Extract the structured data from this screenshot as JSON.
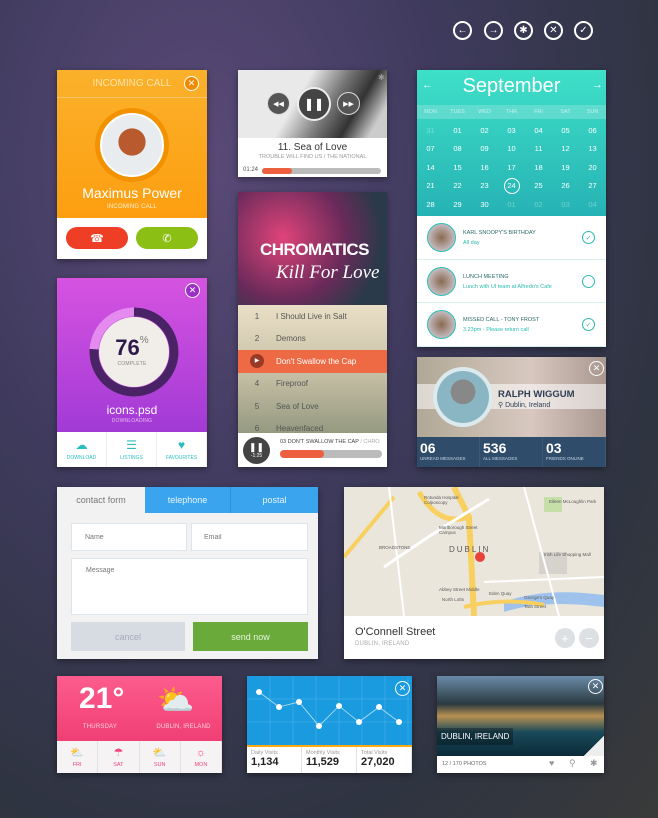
{
  "top_toolbar": {
    "icons": [
      "arrow-left-icon",
      "arrow-right-icon",
      "gear-icon",
      "close-icon",
      "check-icon"
    ]
  },
  "call": {
    "header": "INCOMING CALL",
    "name": "Maximus Power",
    "status": "INCOMING CALL",
    "color": "#fba21b"
  },
  "player": {
    "title": "11. Sea of Love",
    "subtitle": "TROUBLE WILL FIND US  /  THE NATIONAL",
    "time": "01:24",
    "progress": 0.25
  },
  "album": {
    "art_title": "CHROMATICS",
    "art_subtitle": "Kill For Love",
    "tracks": [
      {
        "n": "1",
        "title": "I Should Live in Salt"
      },
      {
        "n": "2",
        "title": "Demons"
      },
      {
        "n": "3",
        "title": "Don't Swallow the Cap",
        "active": true
      },
      {
        "n": "4",
        "title": "Fireproof"
      },
      {
        "n": "5",
        "title": "Sea of Love"
      },
      {
        "n": "6",
        "title": "Heavenfaced"
      }
    ],
    "now_playing": "03 DON'T SWALLOW THE CAP",
    "now_playing_sep": " / CHRO",
    "remaining": "-1:25",
    "progress": 0.43
  },
  "calendar": {
    "month": "September",
    "weekdays": [
      "MON",
      "TUES",
      "WED",
      "THR",
      "FRI",
      "SAT",
      "SUN"
    ],
    "days": [
      [
        "31",
        "01",
        "02",
        "03",
        "04",
        "05",
        "06"
      ],
      [
        "07",
        "08",
        "09",
        "10",
        "11",
        "12",
        "13"
      ],
      [
        "14",
        "15",
        "16",
        "17",
        "18",
        "19",
        "20"
      ],
      [
        "21",
        "22",
        "23",
        "24",
        "25",
        "26",
        "27"
      ],
      [
        "28",
        "29",
        "30",
        "01",
        "02",
        "03",
        "04"
      ]
    ],
    "selected": "24",
    "events": [
      {
        "title": "KARL SNOOPY'S BIRTHDAY",
        "detail": "All day",
        "done": true
      },
      {
        "title": "LUNCH MEETING",
        "detail": "Lunch with UI team at Alfredo's Cafe",
        "done": false
      },
      {
        "title": "MISSED CALL - TONY FROST",
        "detail": "3.23pm - Please return call",
        "done": true
      }
    ]
  },
  "download": {
    "percent": "76",
    "percent_sign": "%",
    "complete_label": "COMPLETE",
    "file": "icons.psd",
    "status": "DOWNLOADING",
    "progress": 0.76,
    "tabs": [
      {
        "label": "DOWNLOAD",
        "icon": "cloud-download-icon"
      },
      {
        "label": "LISTINGS",
        "icon": "list-icon"
      },
      {
        "label": "FAVOURITES",
        "icon": "heart-icon"
      }
    ]
  },
  "profile": {
    "name": "RALPH WIGGUM",
    "location": "Dublin, Ireland",
    "stats": [
      {
        "value": "06",
        "label": "UNREAD MESSAGES"
      },
      {
        "value": "536",
        "label": "ALL MESSAGES"
      },
      {
        "value": "03",
        "label": "FRIENDS ONLINE"
      }
    ]
  },
  "contact": {
    "tabs": [
      "contact form",
      "telephone",
      "postal"
    ],
    "name_placeholder": "Name",
    "email_placeholder": "Email",
    "message_placeholder": "Message",
    "cancel": "cancel",
    "send": "send now"
  },
  "map": {
    "street": "O'Connell Street",
    "city": "DUBLIN, IRELAND",
    "labels": [
      "Rotunda Hospital Colposcopy",
      "Marlborough Street Campus",
      "Eileen McLoughlin Park",
      "Irish Life Shopping Mall",
      "BROADSTONE",
      "DUBLIN",
      "Abbey Street Middle",
      "Eden Quay",
      "George's Quay",
      "Tara Street",
      "North Lotts"
    ],
    "zoom_in": "+",
    "zoom_out": "−"
  },
  "weather": {
    "temp": "21°",
    "day": "THURSDAY",
    "city": "DUBLIN, IRELAND",
    "forecast": [
      {
        "day": "FRI",
        "icon": "partly-cloudy-icon"
      },
      {
        "day": "SAT",
        "icon": "rain-icon"
      },
      {
        "day": "SUN",
        "icon": "partly-cloudy-icon"
      },
      {
        "day": "MON",
        "icon": "sun-icon"
      }
    ]
  },
  "stats_widget": {
    "items": [
      {
        "label": "Daily Visits",
        "value": "1,134"
      },
      {
        "label": "Monthly Visits",
        "value": "11,529"
      },
      {
        "label": "Total Visits",
        "value": "27,020"
      }
    ]
  },
  "chart_data": {
    "type": "line",
    "values": [
      54,
      39,
      44,
      20,
      40,
      24,
      39,
      24
    ],
    "color": "#ffffff",
    "background": "#1a9be0",
    "grid": true
  },
  "photo": {
    "caption": "DUBLIN, IRELAND",
    "count": "12 / 170 PHOTOS"
  }
}
